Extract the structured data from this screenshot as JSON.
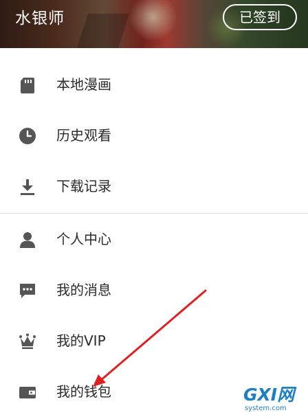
{
  "header": {
    "username": "水银师",
    "checkin_label": "已签到"
  },
  "menu": {
    "items": [
      {
        "label": "本地漫画",
        "icon": "sd-card-icon"
      },
      {
        "label": "历史观看",
        "icon": "clock-icon"
      },
      {
        "label": "下载记录",
        "icon": "download-icon"
      },
      {
        "label": "个人中心",
        "icon": "person-icon"
      },
      {
        "label": "我的消息",
        "icon": "message-icon"
      },
      {
        "label": "我的VIP",
        "icon": "crown-icon"
      },
      {
        "label": "我的钱包",
        "icon": "wallet-icon"
      }
    ]
  },
  "watermark": {
    "logo": "GXI网",
    "site": "system.com"
  },
  "colors": {
    "icon": "#555555",
    "text": "#2b2b2b",
    "annotation_arrow": "#e02020",
    "watermark": "#1d7fc4"
  }
}
